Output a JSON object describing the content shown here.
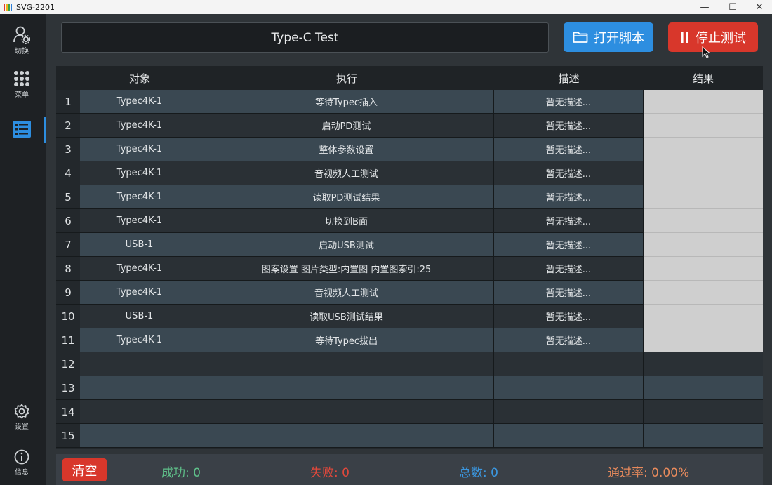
{
  "window": {
    "title": "SVG-2201",
    "minimize": "—",
    "maximize": "☐",
    "close": "✕"
  },
  "sidebar": {
    "items": [
      {
        "label": "切换",
        "icon": "user-gear-icon"
      },
      {
        "label": "菜单",
        "icon": "grid-menu-icon"
      },
      {
        "label": "",
        "icon": "checklist-icon"
      },
      {
        "label": "设置",
        "icon": "gear-icon"
      },
      {
        "label": "信息",
        "icon": "info-icon"
      }
    ]
  },
  "header": {
    "script_title": "Type-C Test",
    "open_script_label": "打开脚本",
    "stop_test_label": "停止测试"
  },
  "table": {
    "columns": [
      "对象",
      "执行",
      "描述",
      "结果"
    ],
    "rows": [
      {
        "index": "1",
        "object": "Typec4K-1",
        "action": "等待Typec插入",
        "desc": "暂无描述..."
      },
      {
        "index": "2",
        "object": "Typec4K-1",
        "action": "启动PD测试",
        "desc": "暂无描述..."
      },
      {
        "index": "3",
        "object": "Typec4K-1",
        "action": "整体参数设置",
        "desc": "暂无描述..."
      },
      {
        "index": "4",
        "object": "Typec4K-1",
        "action": "音视频人工测试",
        "desc": "暂无描述..."
      },
      {
        "index": "5",
        "object": "Typec4K-1",
        "action": "读取PD测试结果",
        "desc": "暂无描述..."
      },
      {
        "index": "6",
        "object": "Typec4K-1",
        "action": "切换到B面",
        "desc": "暂无描述..."
      },
      {
        "index": "7",
        "object": "USB-1",
        "action": "启动USB测试",
        "desc": "暂无描述..."
      },
      {
        "index": "8",
        "object": "Typec4K-1",
        "action": "图案设置 图片类型:内置图 内置图索引:25",
        "desc": "暂无描述..."
      },
      {
        "index": "9",
        "object": "Typec4K-1",
        "action": "音视频人工测试",
        "desc": "暂无描述..."
      },
      {
        "index": "10",
        "object": "USB-1",
        "action": "读取USB测试结果",
        "desc": "暂无描述..."
      },
      {
        "index": "11",
        "object": "Typec4K-1",
        "action": "等待Typec拔出",
        "desc": "暂无描述..."
      }
    ],
    "empty_rows": [
      "12",
      "13",
      "14",
      "15"
    ]
  },
  "footer": {
    "clear_label": "清空",
    "success_label": "成功:",
    "success_value": "0",
    "fail_label": "失败:",
    "fail_value": "0",
    "total_label": "总数:",
    "total_value": "0",
    "pass_rate_label": "通过率:",
    "pass_rate_value": "0.00%"
  },
  "colors": {
    "success": "#5fc08a",
    "fail": "#e0483b",
    "total": "#3b97e0",
    "pass_rate": "#e88a5c",
    "accent_blue": "#2d8ee0",
    "accent_red": "#d8372b"
  }
}
